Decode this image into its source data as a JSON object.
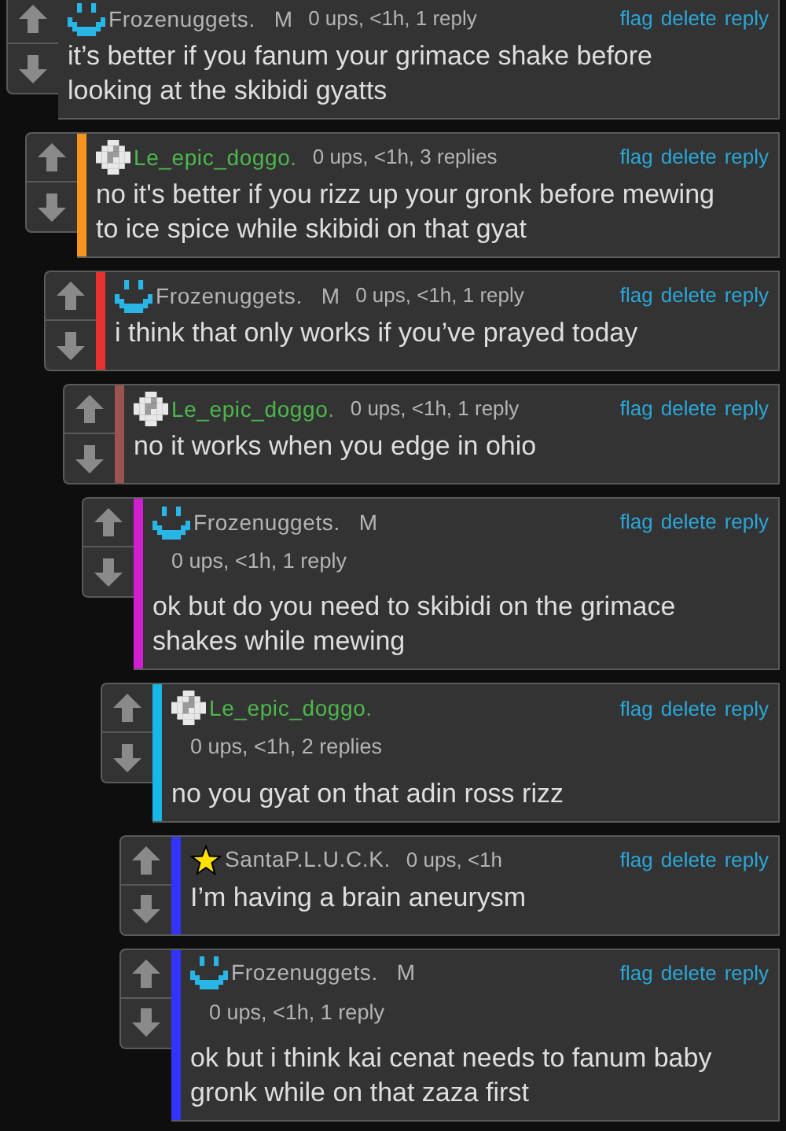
{
  "comments": [
    {
      "author": {
        "name": "Frozenuggets.",
        "color": "#b4b4b4"
      },
      "avatar": {
        "kind": "smiley"
      },
      "badge": "M",
      "meta": "0 ups, <1h, 1 reply",
      "meta_on_own_line": false,
      "actions": [
        "flag",
        "delete",
        "reply"
      ],
      "text": "it’s better if you fanum your grimace shake before looking at the skibidi gyatts",
      "children": [
        {
          "author": {
            "name": "Le_epic_doggo.",
            "color": "#4cb84c"
          },
          "avatar": {
            "kind": "checker"
          },
          "meta": "0 ups, <1h, 3 replies",
          "meta_on_own_line": false,
          "color": "#f7941d",
          "actions": [
            "flag",
            "delete",
            "reply"
          ],
          "text": "no it's better if you rizz up your gronk before mewing to ice spice while skibidi on that gyat",
          "children": [
            {
              "author": {
                "name": "Frozenuggets.",
                "color": "#b4b4b4"
              },
              "avatar": {
                "kind": "smiley"
              },
              "badge": "M",
              "meta": "0 ups, <1h, 1 reply",
              "meta_on_own_line": false,
              "color": "#e8322f",
              "actions": [
                "flag",
                "delete",
                "reply"
              ],
              "text": "i think that only works if you’ve prayed today",
              "children": [
                {
                  "author": {
                    "name": "Le_epic_doggo.",
                    "color": "#4cb84c"
                  },
                  "avatar": {
                    "kind": "checker"
                  },
                  "meta": "0 ups, <1h, 1 reply",
                  "meta_on_own_line": false,
                  "color": "#9c5450",
                  "actions": [
                    "flag",
                    "delete",
                    "reply"
                  ],
                  "text": "no it works when you edge in ohio",
                  "children": [
                    {
                      "author": {
                        "name": "Frozenuggets.",
                        "color": "#b4b4b4"
                      },
                      "avatar": {
                        "kind": "smiley"
                      },
                      "badge": "M",
                      "meta": "0 ups, <1h, 1 reply",
                      "meta_on_own_line": true,
                      "color": "#d01fd0",
                      "actions": [
                        "flag",
                        "delete",
                        "reply"
                      ],
                      "text": "ok but do you need to skibidi on the grimace shakes while mewing",
                      "children": [
                        {
                          "author": {
                            "name": "Le_epic_doggo.",
                            "color": "#4cb84c"
                          },
                          "avatar": {
                            "kind": "checker"
                          },
                          "meta": "0 ups, <1h, 2 replies",
                          "meta_on_own_line": true,
                          "color": "#17b7e8",
                          "actions": [
                            "flag",
                            "delete",
                            "reply"
                          ],
                          "text": "no you gyat on that adin ross rizz",
                          "children": [
                            {
                              "author": {
                                "name": "SantaP.L.U.C.K.",
                                "color": "#b4b4b4"
                              },
                              "avatar": {
                                "kind": "star"
                              },
                              "meta": "0 ups, <1h",
                              "meta_on_own_line": false,
                              "color": "#3333ff",
                              "actions": [
                                "flag",
                                "delete",
                                "reply"
                              ],
                              "text": "I’m having a brain aneurysm"
                            },
                            {
                              "author": {
                                "name": "Frozenuggets.",
                                "color": "#b4b4b4"
                              },
                              "avatar": {
                                "kind": "smiley"
                              },
                              "badge": "M",
                              "meta": "0 ups, <1h, 1 reply",
                              "meta_on_own_line": true,
                              "color": "#3333ff",
                              "actions": [
                                "flag",
                                "delete",
                                "reply"
                              ],
                              "text": "ok but i think kai cenat needs to fanum baby gronk while on that zaza first"
                            }
                          ]
                        }
                      ]
                    }
                  ]
                }
              ]
            }
          ]
        }
      ]
    }
  ]
}
